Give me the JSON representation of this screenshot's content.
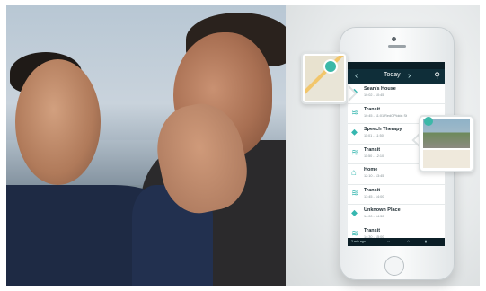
{
  "app": {
    "nav": {
      "prev": "‹",
      "title": "Today",
      "next": "›",
      "runner_icon": "runner-icon"
    },
    "timeline": [
      {
        "title": "Sean's House",
        "time": "10:02 - 10:45",
        "duration": "",
        "icon": "place-pin-icon"
      },
      {
        "title": "Transit",
        "time": "10:45 - 11:01  RedOPlokin St",
        "duration": "",
        "icon": "transit-icon"
      },
      {
        "title": "Speech Therapy",
        "time": "11:01 - 11:50",
        "duration": "",
        "icon": "place-pin-icon"
      },
      {
        "title": "Transit",
        "time": "11:50 - 12:10",
        "duration": "",
        "icon": "transit-icon"
      },
      {
        "title": "Home",
        "time": "12:10 - 13:45",
        "duration": "",
        "icon": "home-icon"
      },
      {
        "title": "Transit",
        "time": "13:45 - 14:00",
        "duration": "",
        "icon": "transit-icon"
      },
      {
        "title": "Unknown Place",
        "time": "14:00 - 14:30",
        "duration": "",
        "icon": "place-pin-icon"
      },
      {
        "title": "Transit",
        "time": "14:30 - 15:00",
        "duration": "",
        "icon": "transit-icon"
      }
    ],
    "bottom_bar": {
      "updated": "2 min ago",
      "battery": "",
      "wifi": "",
      "signal": ""
    }
  },
  "colors": {
    "accent": "#36b7b0",
    "navbar": "#0f2e39",
    "statusbar": "#0b1e26"
  }
}
